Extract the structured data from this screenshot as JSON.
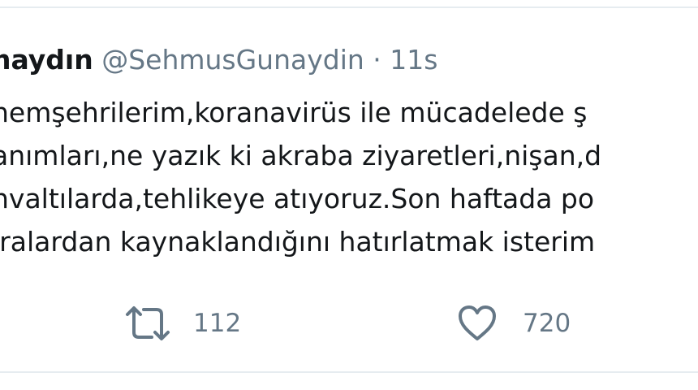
{
  "tweet": {
    "author_name": "naydın",
    "author_handle": "@SehmusGunaydin",
    "separator": "·",
    "timestamp": "11s",
    "lines": [
      "hemşehrilerim,koranavirüs ile mücadelede ş",
      "anımları,ne yazık ki akraba ziyaretleri,nişan,d",
      "hvaltılarda,tehlikeye atıyoruz.Son haftada po",
      "ıralardan kaynaklandığını hatırlatmak isterim"
    ],
    "retweet_count": "112",
    "like_count": "720"
  },
  "icons": {
    "retweet": "retweet-icon",
    "like": "heart-icon"
  },
  "colors": {
    "text": "#14171a",
    "muted": "#657786",
    "border": "#e6ecf0"
  }
}
